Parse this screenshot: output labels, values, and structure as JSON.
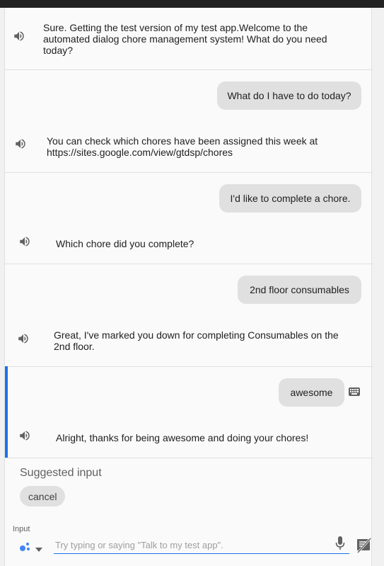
{
  "conversation": {
    "messages": [
      {
        "role": "assistant",
        "text": "Sure. Getting the test version of my test app.Welcome to the automated dialog chore management system! What do you need today?"
      },
      {
        "role": "user",
        "text": "What do I have to do today?"
      },
      {
        "role": "assistant",
        "text": "You can check which chores have been assigned this week at https://sites.google.com/view/gtdsp/chores"
      },
      {
        "role": "user",
        "text": "I'd like to complete a chore."
      },
      {
        "role": "assistant",
        "text": "Which chore did you complete?"
      },
      {
        "role": "user",
        "text": "2nd floor consumables"
      },
      {
        "role": "assistant",
        "text": "Great, I've marked you down for completing Consumables on the 2nd floor."
      },
      {
        "role": "user",
        "text": "awesome"
      },
      {
        "role": "assistant",
        "text": "Alright, thanks for being awesome and doing your chores!"
      }
    ]
  },
  "suggestions": {
    "label": "Suggested input",
    "chips": [
      "cancel"
    ]
  },
  "input": {
    "label": "Input",
    "placeholder": "Try typing or saying \"Talk to my test app\".",
    "value": ""
  },
  "colors": {
    "accent": "#1a73e8",
    "bubble": "#e0e0e0",
    "topbar": "#222222"
  },
  "icons": {
    "speaker": "speaker-icon",
    "keyboard": "keyboard-icon",
    "assistant": "google-assistant-dots-icon",
    "dropdown": "chevron-down-icon",
    "mic": "microphone-icon",
    "mute": "speaker-off-icon"
  }
}
